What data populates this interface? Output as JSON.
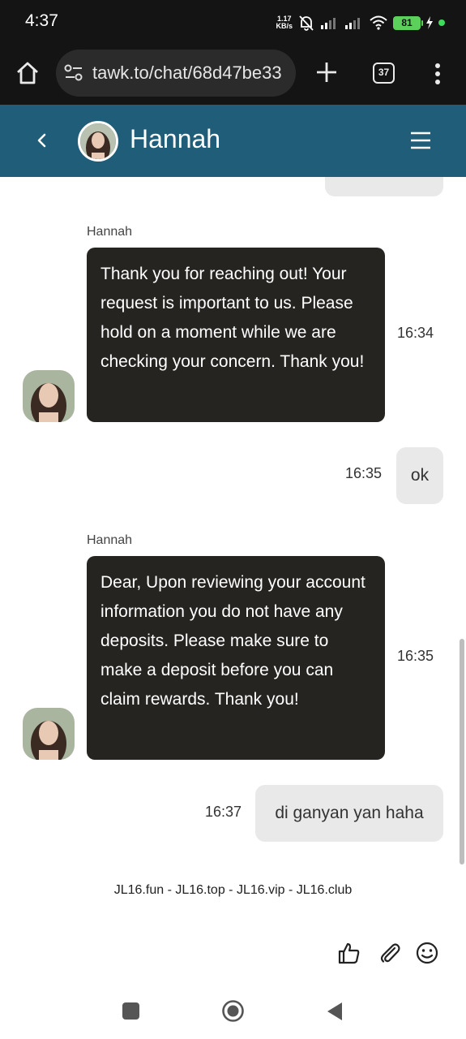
{
  "status_bar": {
    "time": "4:37",
    "speed_value": "1.17",
    "speed_unit": "KB/s",
    "battery": "81"
  },
  "browser": {
    "url": "tawk.to/chat/68d47be33",
    "tab_count": "37"
  },
  "chat_header": {
    "agent_name": "Hannah"
  },
  "messages": [
    {
      "sender": "Hannah",
      "text": "Thank you for reaching out! Your request is important to us. Please hold on a moment while we are checking your concern. Thank you!",
      "time": "16:34"
    },
    {
      "text": "ok",
      "time": "16:35"
    },
    {
      "sender": "Hannah",
      "text": "Dear, Upon reviewing your account information you do not have any deposits. Please make sure to make a deposit before you can claim rewards. Thank you!",
      "time": "16:35"
    },
    {
      "text": "di ganyan yan haha",
      "time": "16:37"
    }
  ],
  "footer": {
    "links_text": "JL16.fun - JL16.top - JL16.vip - JL16.club"
  },
  "icons": {
    "rating": "thumbs-up-icon",
    "attach": "paperclip-icon",
    "emoji": "smiley-icon"
  },
  "colors": {
    "header_bg": "#1f5d78",
    "agent_bubble": "#262421",
    "user_bubble": "#e9e9e9",
    "system_bar": "#141414"
  }
}
